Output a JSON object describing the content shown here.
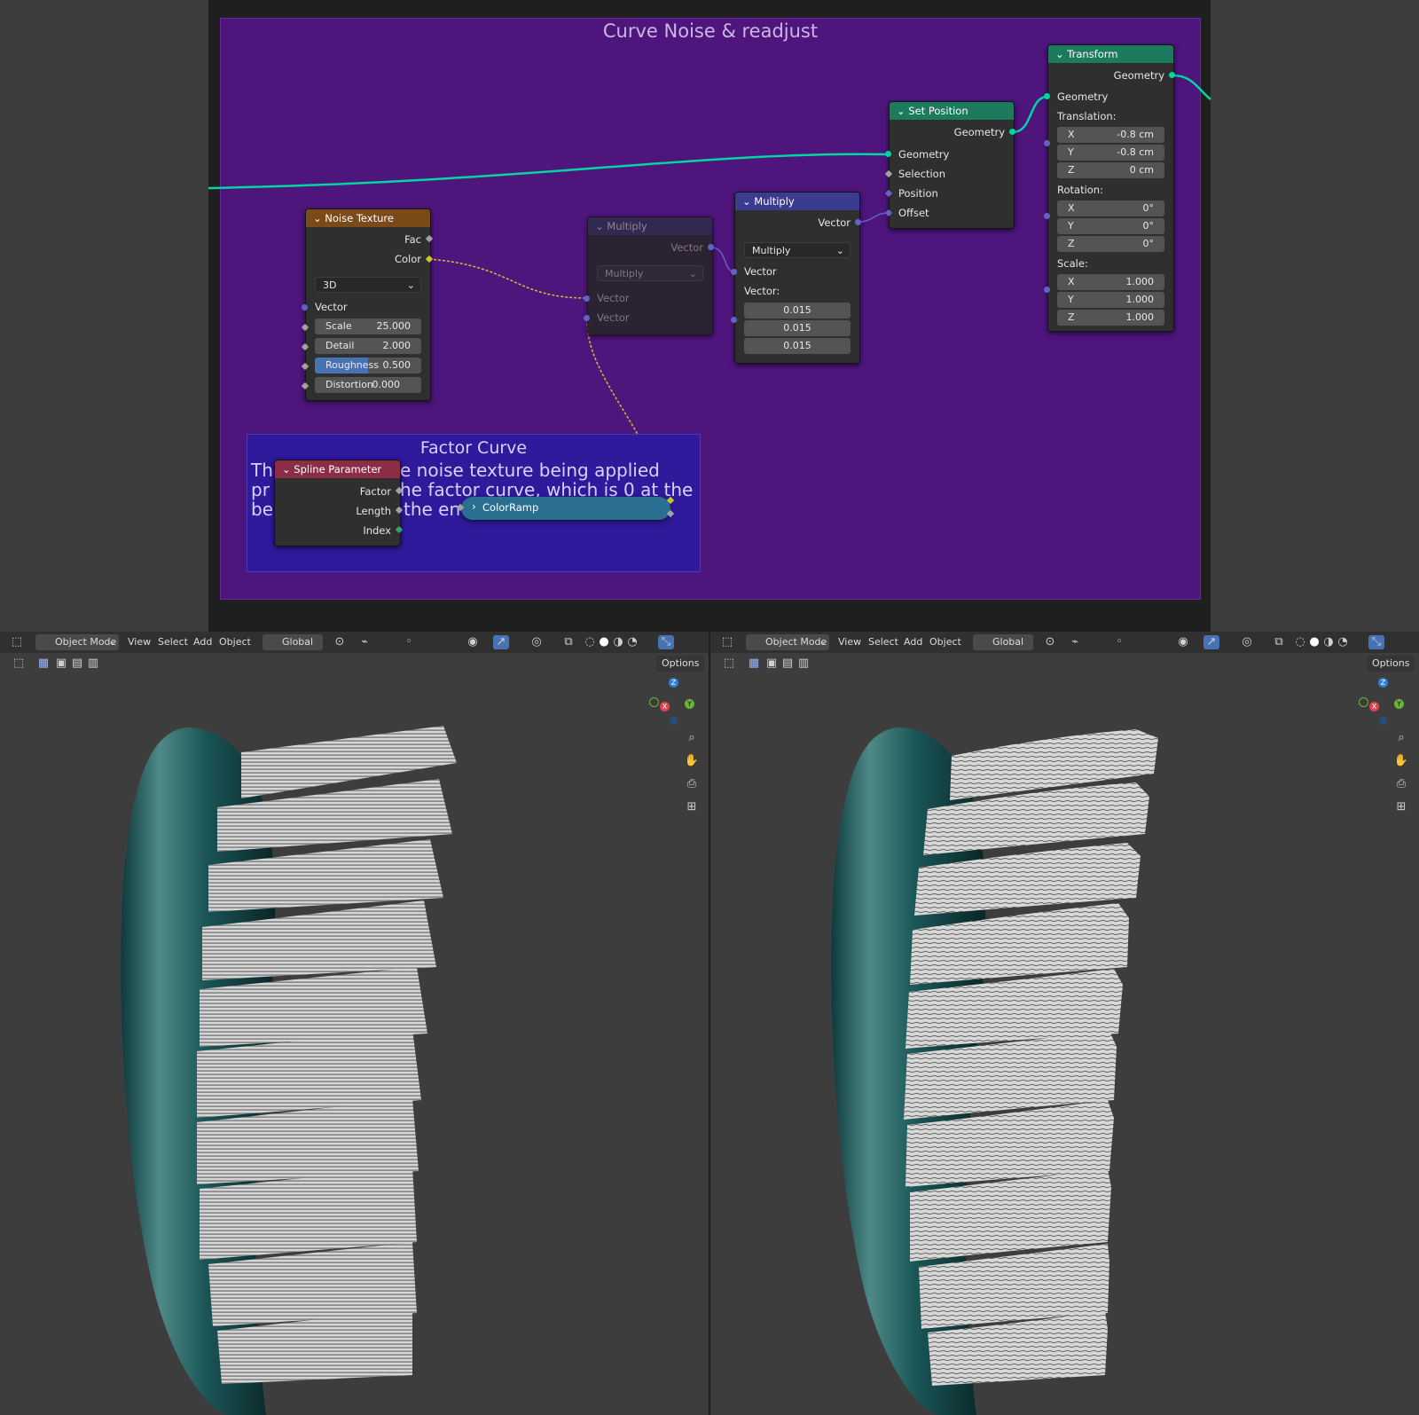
{
  "node_editor": {
    "frame_title": "Curve Noise & readjust",
    "factor_frame": {
      "title": "Factor Curve",
      "text_lines": [
        "Th",
        "e noise texture being applied",
        "pr",
        "he factor curve, which is 0 at the",
        "be",
        "the en"
      ]
    },
    "noise_texture": {
      "header": "Noise Texture",
      "out_fac": "Fac",
      "out_color": "Color",
      "dimensions": "3D",
      "in_vector": "Vector",
      "scale_label": "Scale",
      "scale_value": "25.000",
      "detail_label": "Detail",
      "detail_value": "2.000",
      "roughness_label": "Roughness",
      "roughness_value": "0.500",
      "roughness_fill": 0.5,
      "distortion_label": "Distortion",
      "distortion_value": "0.000"
    },
    "multiply_dim": {
      "header": "Multiply",
      "out_vector": "Vector",
      "operation": "Multiply",
      "in_vector_1": "Vector",
      "in_vector_2": "Vector"
    },
    "multiply_vector": {
      "header": "Multiply",
      "out_vector": "Vector",
      "operation": "Multiply",
      "in_vector": "Vector",
      "vector_label": "Vector:",
      "values": [
        "0.015",
        "0.015",
        "0.015"
      ]
    },
    "set_position": {
      "header": "Set Position",
      "out_geometry": "Geometry",
      "in_geometry": "Geometry",
      "in_selection": "Selection",
      "in_position": "Position",
      "in_offset": "Offset"
    },
    "transform": {
      "header": "Transform",
      "out_geometry": "Geometry",
      "in_geometry": "Geometry",
      "translation_label": "Translation:",
      "translation": [
        {
          "axis": "X",
          "value": "-0.8 cm"
        },
        {
          "axis": "Y",
          "value": "-0.8 cm"
        },
        {
          "axis": "Z",
          "value": "0 cm"
        }
      ],
      "rotation_label": "Rotation:",
      "rotation": [
        {
          "axis": "X",
          "value": "0°"
        },
        {
          "axis": "Y",
          "value": "0°"
        },
        {
          "axis": "Z",
          "value": "0°"
        }
      ],
      "scale_label": "Scale:",
      "scale": [
        {
          "axis": "X",
          "value": "1.000"
        },
        {
          "axis": "Y",
          "value": "1.000"
        },
        {
          "axis": "Z",
          "value": "1.000"
        }
      ]
    },
    "spline_parameter": {
      "header": "Spline Parameter",
      "out_factor": "Factor",
      "out_length": "Length",
      "out_index": "Index"
    },
    "color_ramp": {
      "header": "ColorRamp"
    },
    "colors": {
      "frame_purple": "#4e157c",
      "frame_blue": "#2e1a9a",
      "geometry_socket": "#00d6a3",
      "vector_socket": "#6363c7",
      "color_socket": "#c7c729",
      "float_socket": "#a1a1a1",
      "int_socket": "#35a359",
      "header_texture": "#7a4a18",
      "header_vector": "#3b3b8f",
      "header_geometry": "#1c7a5e",
      "header_input": "#8c2d48",
      "header_converter": "#2a6f8f"
    }
  },
  "viewports": [
    {
      "mode": "Object Mode",
      "menu": [
        "View",
        "Select",
        "Add",
        "Object"
      ],
      "orientation": "Global",
      "options": "Options",
      "variant": "straight"
    },
    {
      "mode": "Object Mode",
      "menu": [
        "View",
        "Select",
        "Add",
        "Object"
      ],
      "orientation": "Global",
      "options": "Options",
      "variant": "noisy"
    }
  ],
  "gizmo": {
    "z": "Z",
    "x": "X",
    "y": "Y"
  }
}
